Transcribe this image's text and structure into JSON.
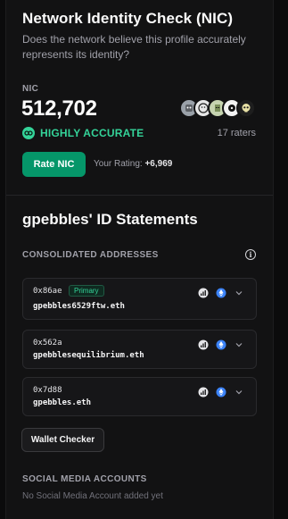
{
  "nic": {
    "title": "Network Identity Check (NIC)",
    "description": "Does the network believe this profile accurately represents its identity?",
    "label": "NIC",
    "value": "512,702",
    "status": "HIGHLY ACCURATE",
    "raters_count": "17 raters",
    "rate_button": "Rate NIC",
    "your_rating_label": "Your Rating:",
    "your_rating_value": "+6,969",
    "rater_avatars": [
      {
        "icon": "avatar-robot",
        "color": "#9aa1a9"
      },
      {
        "icon": "avatar-face-white",
        "color": "#e8e8e8"
      },
      {
        "icon": "avatar-punk",
        "color": "#c6d4b0"
      },
      {
        "icon": "avatar-disc",
        "color": "#f2f2f2"
      },
      {
        "icon": "avatar-skull",
        "color": "#e9e2a6"
      }
    ]
  },
  "id": {
    "title": "gpebbles' ID Statements",
    "consolidated_label": "CONSOLIDATED ADDRESSES",
    "addresses": [
      {
        "short": "0x86ae",
        "ens": "gpebbles6529ftw.eth",
        "badge": "Primary"
      },
      {
        "short": "0x562a",
        "ens": "gpebblesequilibrium.eth"
      },
      {
        "short": "0x7d88",
        "ens": "gpebbles.eth"
      }
    ],
    "wallet_checker": "Wallet Checker",
    "social_label": "SOCIAL MEDIA ACCOUNTS",
    "social_empty": "No Social Media Account added yet"
  },
  "colors": {
    "accent_green": "#059669",
    "status_green": "#34d399",
    "ethereum_blue": "#3b82f6"
  }
}
